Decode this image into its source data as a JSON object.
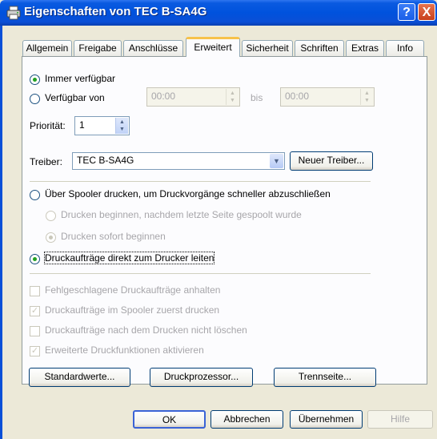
{
  "window": {
    "title": "Eigenschaften von TEC B-SA4G",
    "help_label": "?",
    "close_label": "X"
  },
  "tabs": [
    {
      "label": "Allgemein"
    },
    {
      "label": "Freigabe"
    },
    {
      "label": "Anschlüsse"
    },
    {
      "label": "Erweitert"
    },
    {
      "label": "Sicherheit"
    },
    {
      "label": "Schriften"
    },
    {
      "label": "Extras"
    },
    {
      "label": "Info"
    }
  ],
  "active_tab": "Erweitert",
  "availability": {
    "always_label": "Immer verfügbar",
    "from_label": "Verfügbar von",
    "from_time": "00:00",
    "to_label": "bis",
    "to_time": "00:00"
  },
  "priority": {
    "label": "Priorität:",
    "value": "1"
  },
  "driver": {
    "label": "Treiber:",
    "value": "TEC B-SA4G",
    "new_button": "Neuer Treiber..."
  },
  "spooler": {
    "spool_label": "Über Spooler drucken, um Druckvorgänge schneller abzuschließen",
    "after_last_page_label": "Drucken beginnen, nachdem letzte Seite gespoolt wurde",
    "immediately_label": "Drucken sofort beginnen",
    "direct_label": "Druckaufträge direkt zum Drucker leiten"
  },
  "options": [
    {
      "label": "Fehlgeschlagene Druckaufträge anhalten",
      "checked": false
    },
    {
      "label": "Druckaufträge im Spooler zuerst drucken",
      "checked": true
    },
    {
      "label": "Druckaufträge nach dem Drucken nicht löschen",
      "checked": false
    },
    {
      "label": "Erweiterte Druckfunktionen aktivieren",
      "checked": true
    }
  ],
  "bottom_buttons": {
    "defaults": "Standardwerte...",
    "processor": "Druckprozessor...",
    "separator": "Trennseite..."
  },
  "dialog_buttons": {
    "ok": "OK",
    "cancel": "Abbrechen",
    "apply": "Übernehmen",
    "help": "Hilfe"
  },
  "colors": {
    "title_bar": "#0052dd",
    "dialog_bg": "#ece9d8",
    "panel_bg": "#fcfcfe",
    "active_tab_accent": "#f7c24a",
    "radio_dot": "#21a121"
  }
}
